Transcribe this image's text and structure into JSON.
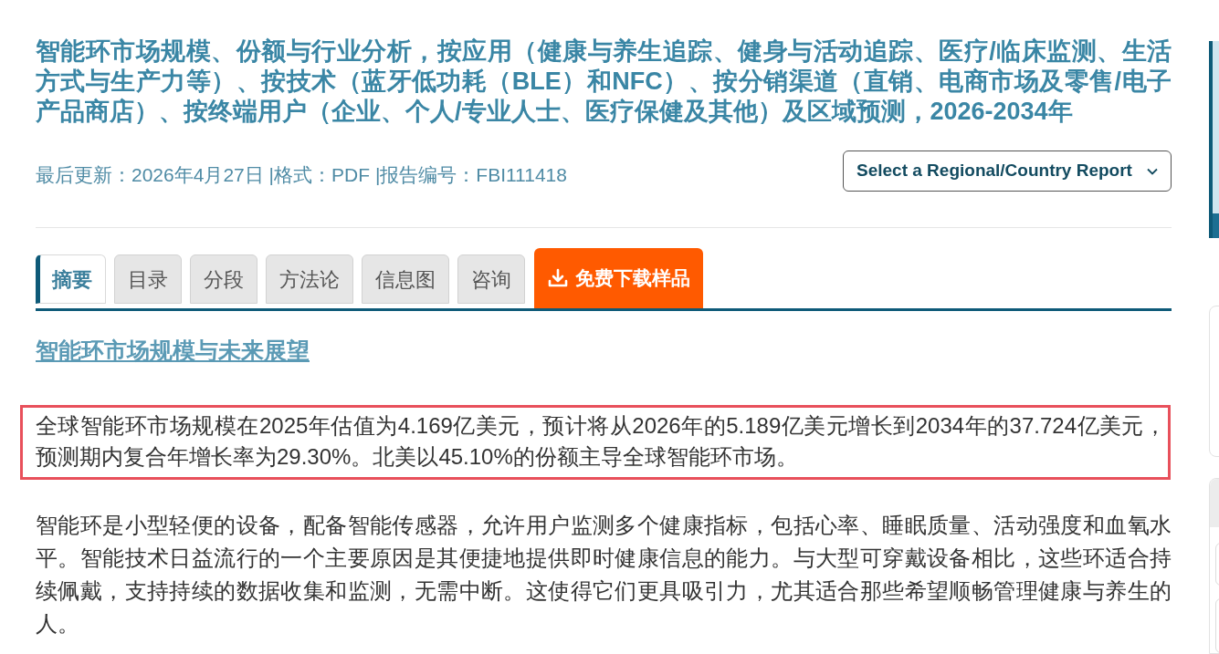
{
  "report": {
    "title": "智能环市场规模、份额与行业分析，按应用（健康与养生追踪、健身与活动追踪、医疗/临床监测、生活方式与生产力等）、按技术（蓝牙低功耗（BLE）和NFC）、按分销渠道（直销、电商市场及零售/电子产品商店）、按终端用户（企业、个人/专业人士、医疗保健及其他）及区域预测，2026-2034年",
    "meta": "最后更新：2026年4月27日 |格式：PDF |报告编号：FBI111418",
    "region_select": {
      "value": "Select a Regional/Country Report"
    }
  },
  "tabs": [
    {
      "label": "摘要",
      "selected": true
    },
    {
      "label": "目录",
      "selected": false
    },
    {
      "label": "分段",
      "selected": false
    },
    {
      "label": "方法论",
      "selected": false
    },
    {
      "label": "信息图",
      "selected": false
    },
    {
      "label": "咨询",
      "selected": false
    }
  ],
  "download_button": {
    "label": "免费下载样品"
  },
  "section": {
    "heading": "智能环市场规模与未来展望",
    "highlight": {
      "text": "全球智能环市场规模在2025年估值为4.169亿美元，预计将从2026年的5.189亿美元增长到2034年的37.724亿美元，预测期内复合年增长率为29.30%。北美以45.10%的份额主导全球智能环市场。",
      "highlighted": true
    },
    "paragraph": "智能环是小型轻便的设备，配备智能传感器，允许用户监测多个健康指标，包括心率、睡眠质量、活动强度和血氧水平。智能技术日益流行的一个主要原因是其便捷地提供即时健康信息的能力。与大型可穿戴设备相比，这些环适合持续佩戴，支持持续的数据收集和监测，无需中断。这使得它们更具吸引力，尤其适合那些希望顺畅管理健康与养生的人。"
  }
}
